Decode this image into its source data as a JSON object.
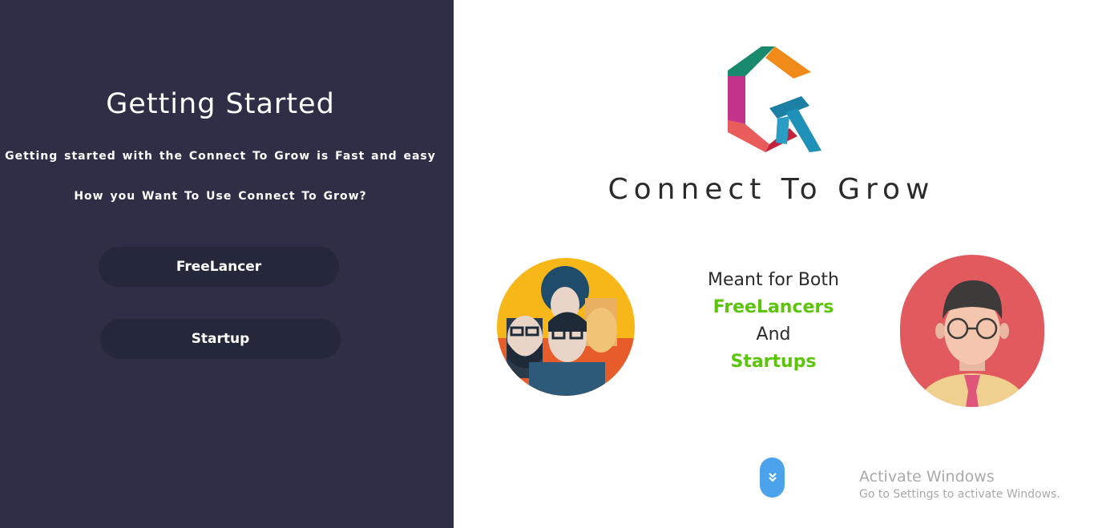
{
  "left": {
    "title": "Getting Started",
    "subtitle": "Getting started with the Connect To Grow is Fast and easy",
    "question": "How you Want To Use Connect To Grow?",
    "buttons": [
      "FreeLancer",
      "Startup"
    ]
  },
  "brand": {
    "name": "Connect To Grow"
  },
  "middle": {
    "line1": "Meant for Both",
    "line2": "FreeLancers",
    "line3": "And",
    "line4": "Startups"
  },
  "icons": {
    "logo": "connect-to-grow-logo",
    "group": "freelancers-group-avatar",
    "single": "startup-person-avatar",
    "scroll": "double-chevron-down-icon"
  },
  "colors": {
    "left_panel": "#2e2f47",
    "button_bg": "#25273a",
    "accent_green": "#5cc50b",
    "scroll_blue": "#4da3eb"
  },
  "watermark": {
    "title": "Activate Windows",
    "subtitle": "Go to Settings to activate Windows."
  }
}
